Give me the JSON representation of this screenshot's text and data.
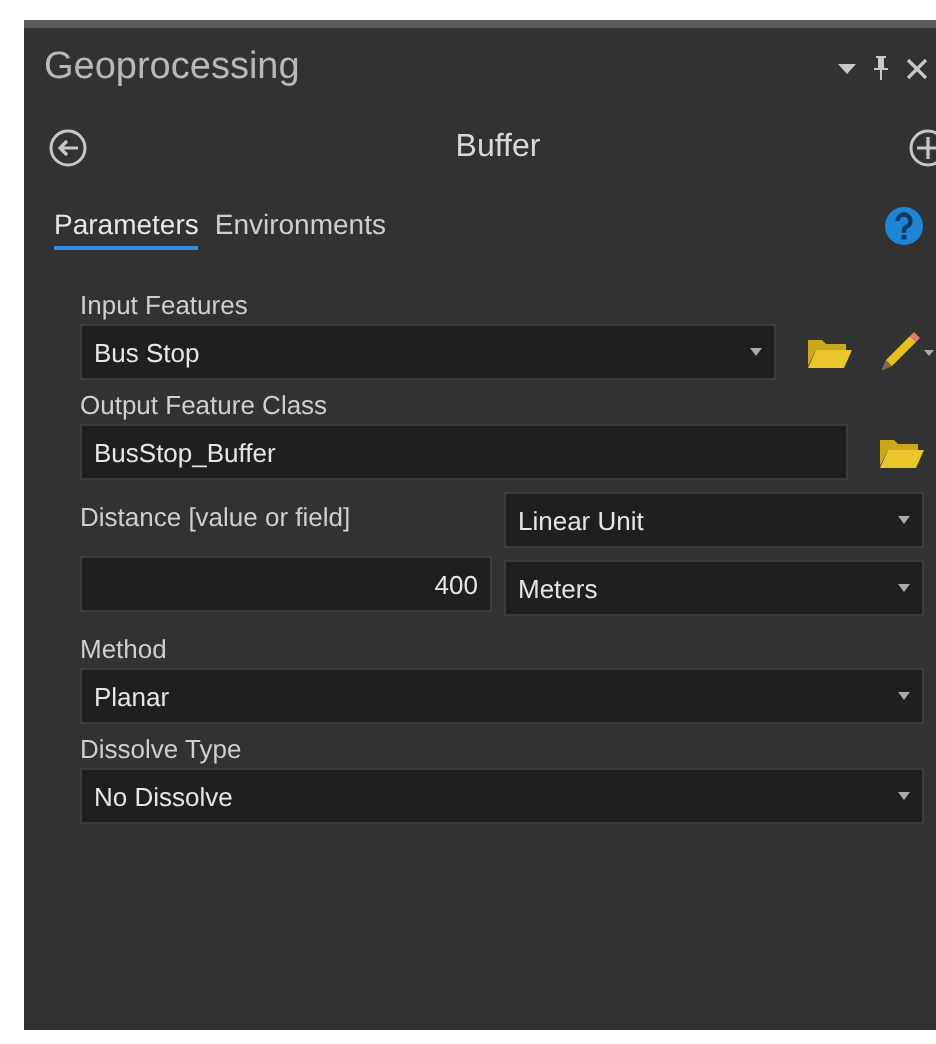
{
  "panel": {
    "title": "Geoprocessing"
  },
  "tool": {
    "title": "Buffer"
  },
  "tabs": [
    {
      "label": "Parameters",
      "selected": true
    },
    {
      "label": "Environments",
      "selected": false
    }
  ],
  "parameters": [
    {
      "kind": "feature_input",
      "label": "Input Features",
      "value": "Bus Stop"
    },
    {
      "kind": "output",
      "label": "Output Feature Class",
      "value": "BusStop_Buffer"
    },
    {
      "kind": "distance",
      "label": "Distance [value or field]",
      "unit_type": "Linear Unit",
      "value": "400",
      "unit": "Meters"
    },
    {
      "kind": "dropdown",
      "label": "Method",
      "value": "Planar"
    },
    {
      "kind": "dropdown",
      "label": "Dissolve Type",
      "value": "No Dissolve"
    }
  ]
}
